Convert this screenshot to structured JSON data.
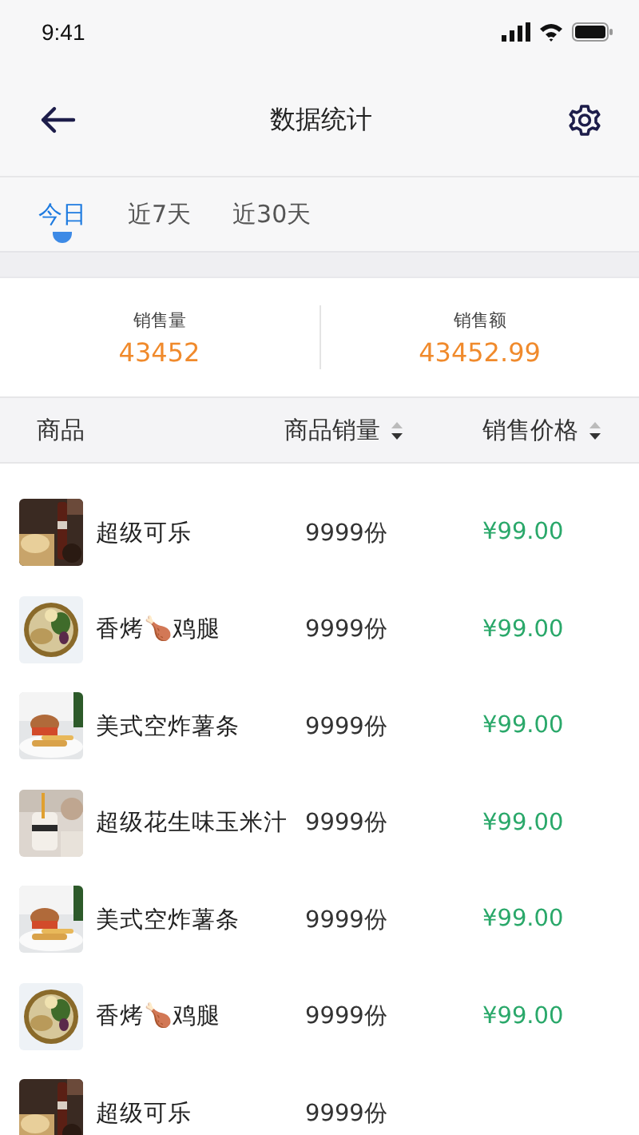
{
  "status_bar": {
    "time": "9:41"
  },
  "nav": {
    "title": "数据统计"
  },
  "tabs": [
    {
      "label": "今日",
      "selected": true
    },
    {
      "label": "近7天",
      "selected": false
    },
    {
      "label": "近30天",
      "selected": false
    }
  ],
  "stats": [
    {
      "label": "销售量",
      "value": "43452"
    },
    {
      "label": "销售额",
      "value": "43452.99"
    }
  ],
  "table": {
    "columns": [
      {
        "label": "商品",
        "sortable": false
      },
      {
        "label": "商品销量",
        "sortable": true
      },
      {
        "label": "销售价格",
        "sortable": true
      }
    ],
    "rows": [
      {
        "kind": "picture",
        "name": "超级可乐",
        "quantity": "9999份",
        "price": "¥99.00"
      },
      {
        "kind": "picture",
        "name": "香烤🍗鸡腿",
        "quantity": "9999份",
        "price": "¥99.00"
      },
      {
        "kind": "picture",
        "name": "美式空炸薯条",
        "quantity": "9999份",
        "price": "¥99.00"
      },
      {
        "kind": "picture",
        "name": "超级花生味玉米汁",
        "quantity": "9999份",
        "price": "¥99.00"
      },
      {
        "kind": "picture",
        "name": "美式空炸薯条",
        "quantity": "9999份",
        "price": "¥99.00"
      },
      {
        "kind": "picture",
        "name": "香烤🍗鸡腿",
        "quantity": "9999份",
        "price": "¥99.00"
      },
      {
        "kind": "picture",
        "name": "超级可乐",
        "quantity": "9999份"
      }
    ]
  }
}
